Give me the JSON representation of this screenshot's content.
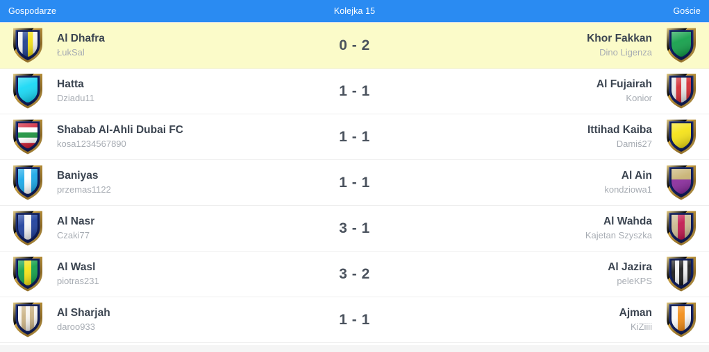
{
  "header": {
    "left_label": "Gospodarze",
    "center_label": "Kolejka 15",
    "right_label": "Goście",
    "bar_color": "#2a8bf2",
    "text_color": "#ffffff"
  },
  "colors": {
    "highlight_row": "#fbfbc9",
    "row_background": "#ffffff",
    "team_name": "#3b4450",
    "team_user": "#a7acb3",
    "score": "#4a525d",
    "divider": "#eeeeee"
  },
  "matches": [
    {
      "highlighted": true,
      "home": {
        "team": "Al Dhafra",
        "user": "ŁukSal",
        "badge_name": "shield-badge-al-dhafra",
        "badge": {
          "pattern": "vstripes",
          "colors": [
            "#f2f2f2",
            "#1d3e8f",
            "#f2e017",
            "#f2f2f2"
          ]
        }
      },
      "score": "0 - 2",
      "home_goals": 0,
      "away_goals": 2,
      "away": {
        "team": "Khor Fakkan",
        "user": "Dino Ligenza",
        "badge_name": "shield-badge-khor-fakkan",
        "badge": {
          "pattern": "solid",
          "colors": [
            "#13a04a"
          ]
        }
      }
    },
    {
      "highlighted": false,
      "home": {
        "team": "Hatta",
        "user": "Dziadu11",
        "badge_name": "shield-badge-hatta",
        "badge": {
          "pattern": "solid",
          "colors": [
            "#17d8f5"
          ]
        }
      },
      "score": "1 - 1",
      "home_goals": 1,
      "away_goals": 1,
      "away": {
        "team": "Al Fujairah",
        "user": "Konior",
        "badge_name": "shield-badge-al-fujairah",
        "badge": {
          "pattern": "vstripes",
          "colors": [
            "#e8e8e8",
            "#d42b33",
            "#e8e8e8",
            "#d42b33"
          ]
        }
      }
    },
    {
      "highlighted": false,
      "home": {
        "team": "Shabab Al-Ahli Dubai FC",
        "user": "kosa1234567890",
        "badge_name": "shield-badge-shabab-al-ahli",
        "badge": {
          "pattern": "hstripes",
          "colors": [
            "#cf1f35",
            "#ffffff",
            "#1e9340",
            "#ffffff",
            "#cf1f35"
          ]
        }
      },
      "score": "1 - 1",
      "home_goals": 1,
      "away_goals": 1,
      "away": {
        "team": "Ittihad Kaiba",
        "user": "Damiś27",
        "badge_name": "shield-badge-ittihad-kaiba",
        "badge": {
          "pattern": "solid",
          "colors": [
            "#f5e216"
          ]
        }
      }
    },
    {
      "highlighted": false,
      "home": {
        "team": "Baniyas",
        "user": "przemas1122",
        "badge_name": "shield-badge-baniyas",
        "badge": {
          "pattern": "vstripes",
          "colors": [
            "#1aa8e8",
            "#ffffff",
            "#1aa8e8"
          ]
        }
      },
      "score": "1 - 1",
      "home_goals": 1,
      "away_goals": 1,
      "away": {
        "team": "Al Ain",
        "user": "kondziowa1",
        "badge_name": "shield-badge-al-ain",
        "badge": {
          "pattern": "hsplit",
          "colors": [
            "#c8b273",
            "#8b2c9e"
          ]
        }
      }
    },
    {
      "highlighted": false,
      "home": {
        "team": "Al Nasr",
        "user": "Czaki77",
        "badge_name": "shield-badge-al-nasr",
        "badge": {
          "pattern": "vstripes",
          "colors": [
            "#1e3f9c",
            "#f5f5f5",
            "#1e3f9c"
          ]
        }
      },
      "score": "3 - 1",
      "home_goals": 3,
      "away_goals": 1,
      "away": {
        "team": "Al Wahda",
        "user": "Kajetan Szyszka",
        "badge_name": "shield-badge-al-wahda",
        "badge": {
          "pattern": "vstripes",
          "colors": [
            "#cbb98f",
            "#c2184f",
            "#cbb98f"
          ]
        }
      }
    },
    {
      "highlighted": false,
      "home": {
        "team": "Al Wasl",
        "user": "piotras231",
        "badge_name": "shield-badge-al-wasl",
        "badge": {
          "pattern": "vstripes",
          "colors": [
            "#13a04a",
            "#f5e216",
            "#13a04a"
          ]
        }
      },
      "score": "3 - 2",
      "home_goals": 3,
      "away_goals": 2,
      "away": {
        "team": "Al Jazira",
        "user": "peleKPS",
        "badge_name": "shield-badge-al-jazira",
        "badge": {
          "pattern": "vstripes",
          "colors": [
            "#1c1c1c",
            "#f2f2f2",
            "#1c1c1c",
            "#f2f2f2",
            "#1c1c1c"
          ]
        }
      }
    },
    {
      "highlighted": false,
      "home": {
        "team": "Al Sharjah",
        "user": "daroo933",
        "badge_name": "shield-badge-al-sharjah",
        "badge": {
          "pattern": "vstripes",
          "colors": [
            "#f7f4ee",
            "#c9b183",
            "#f7f4ee",
            "#c9b183",
            "#f7f4ee"
          ]
        }
      },
      "score": "1 - 1",
      "home_goals": 1,
      "away_goals": 1,
      "away": {
        "team": "Ajman",
        "user": "KiZiiii",
        "badge_name": "shield-badge-ajman",
        "badge": {
          "pattern": "vstripes",
          "colors": [
            "#fafafa",
            "#f28c16",
            "#fafafa"
          ]
        }
      }
    }
  ]
}
